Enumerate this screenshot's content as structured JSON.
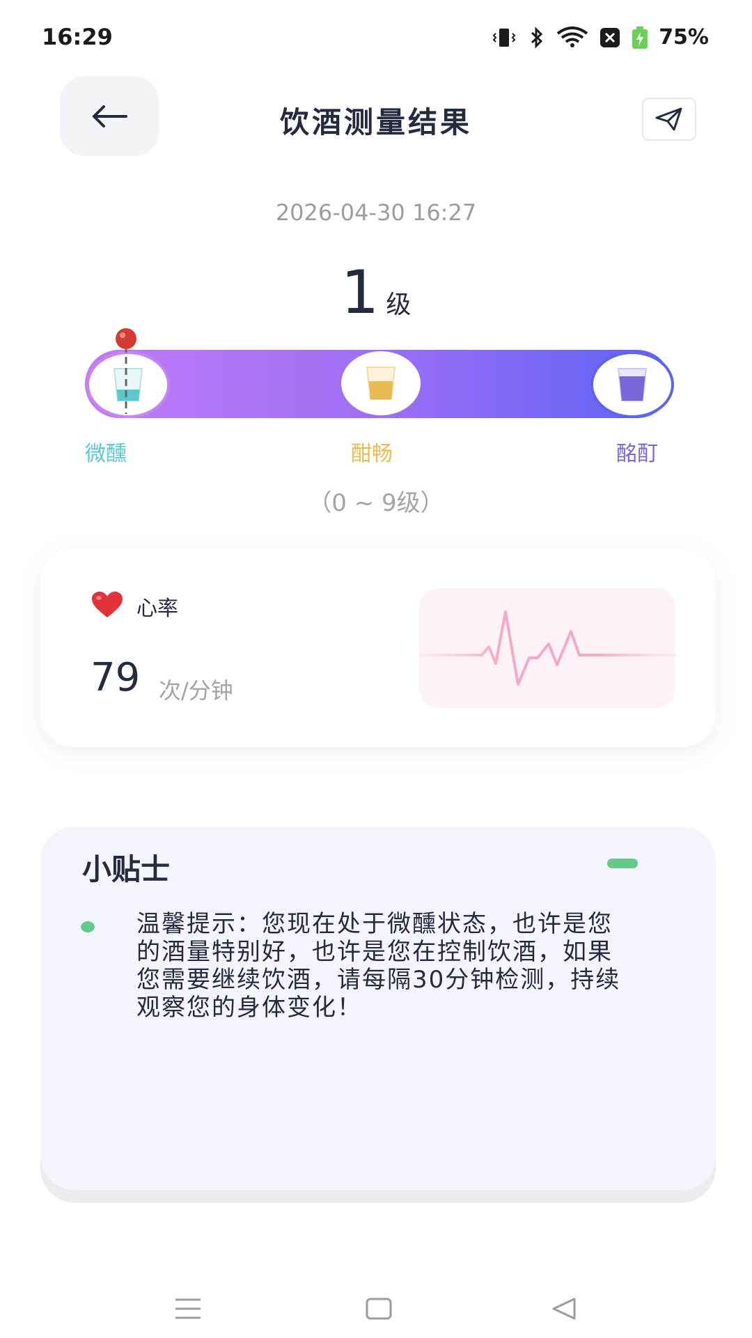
{
  "status_bar": {
    "time": "16:29",
    "battery": "75%"
  },
  "header": {
    "title": "饮酒测量结果"
  },
  "measurement": {
    "timestamp": "2026-04-30 16:27",
    "level_value": "1",
    "level_unit": "级",
    "level_position_fraction": 0.07,
    "scale_labels": [
      "微醺",
      "酣畅",
      "酩酊"
    ],
    "range_text": "（0 ~ 9级）"
  },
  "heart_rate": {
    "label": "心率",
    "value": "79",
    "unit": "次/分钟"
  },
  "tips": {
    "title": "小贴士",
    "text": "温馨提示：您现在处于微醺状态，也许是您的酒量特别好，也许是您在控制饮酒，如果您需要继续饮酒，请每隔30分钟检测，持续观察您的身体变化！"
  },
  "colors": {
    "gradient_start": "#c07cf6",
    "gradient_end": "#5d63f5",
    "label_tipsy": "#5bc8d0",
    "label_merry": "#e9bb52",
    "label_drunk": "#7a66d8",
    "tip_accent": "#66c98c",
    "heart": "#e2333b"
  },
  "icons": {
    "back": "arrow-left-icon",
    "share": "send-icon",
    "heart": "heart-icon",
    "pin": "pin-icon"
  }
}
